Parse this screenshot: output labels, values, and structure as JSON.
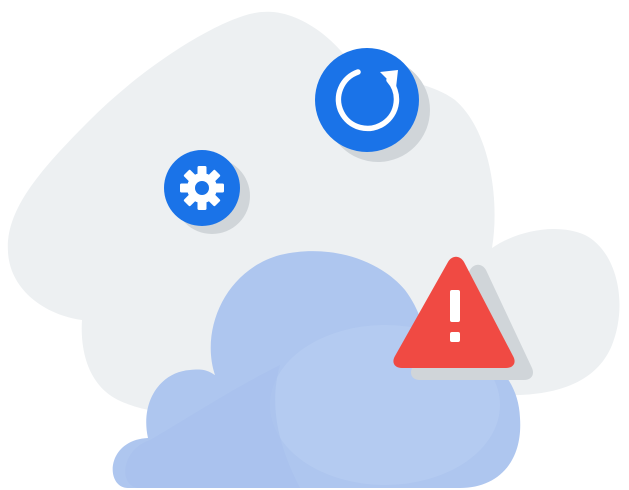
{
  "illustration": {
    "theme": "cloud-sync-error",
    "icons": [
      "refresh-icon",
      "gear-icon",
      "warning-icon",
      "cloud-icon"
    ],
    "colors": {
      "background_blob": "#edf0f2",
      "cloud": "#aec6ef",
      "cloud_highlight": "#b9cff3",
      "badge_blue": "#1a73e8",
      "badge_shadow": "#d0d5d9",
      "warning_red": "#f04a43",
      "icon_white": "#ffffff"
    }
  }
}
